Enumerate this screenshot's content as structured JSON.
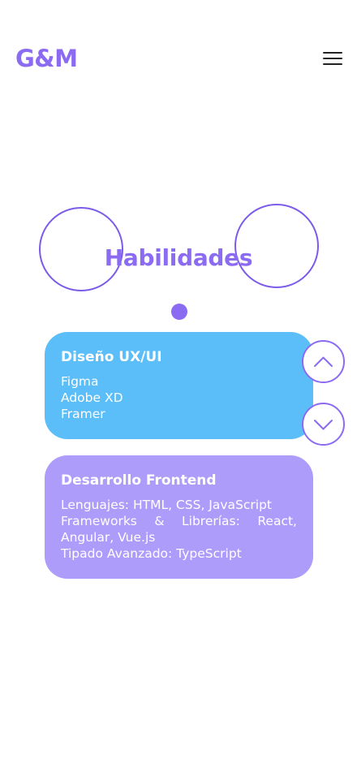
{
  "header": {
    "logo_text": "G&M",
    "menu_icon": "hamburger-menu-icon"
  },
  "section": {
    "title": "Habilidades"
  },
  "cards": [
    {
      "title": "Diseño UX/UI",
      "lines": [
        "Figma",
        "Adobe XD",
        "Framer"
      ],
      "color": "#5BBEF8"
    },
    {
      "title": "Desarrollo Frontend",
      "lines": [
        "Lenguajes: HTML, CSS, JavaScript",
        "Frameworks & Librerías: React, Angular, Vue.js",
        "Tipado Avanzado: TypeScript"
      ],
      "color": "#AE9CFB"
    }
  ],
  "navigation": {
    "up_icon": "chevron-up-icon",
    "down_icon": "chevron-down-icon"
  },
  "colors": {
    "accent": "#8B6BF2",
    "card_ux": "#5BBEF8",
    "card_frontend": "#AE9CFB"
  }
}
